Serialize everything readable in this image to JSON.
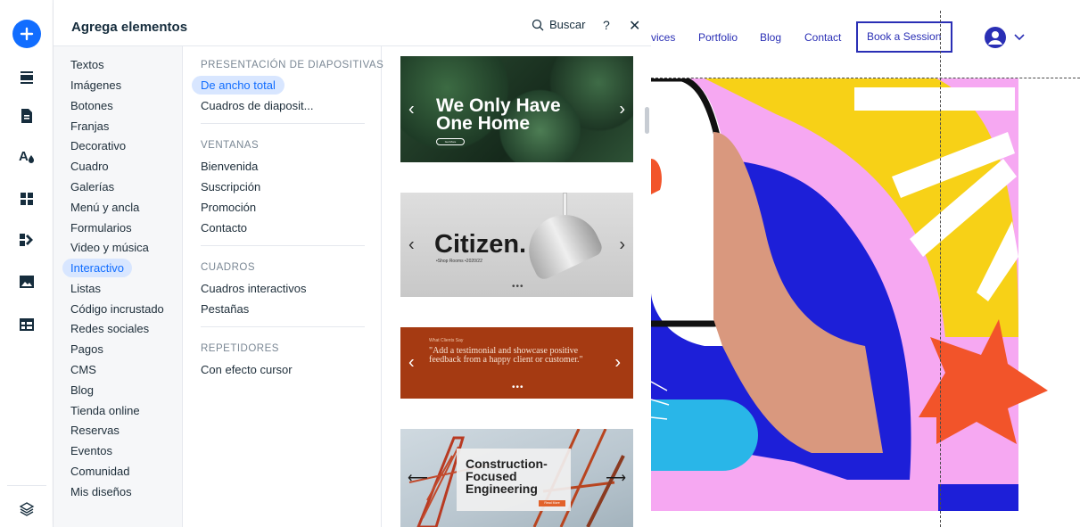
{
  "rail": {
    "items": [
      {
        "name": "add-elements",
        "icon": "plus-icon"
      },
      {
        "name": "sections",
        "icon": "sections-icon"
      },
      {
        "name": "pages",
        "icon": "page-icon"
      },
      {
        "name": "theme",
        "icon": "theme-icon"
      },
      {
        "name": "apps",
        "icon": "apps-icon"
      },
      {
        "name": "business",
        "icon": "business-icon"
      },
      {
        "name": "media",
        "icon": "image-icon"
      },
      {
        "name": "cms",
        "icon": "table-icon"
      },
      {
        "name": "layers",
        "icon": "layers-icon"
      }
    ],
    "accent": "#116dff"
  },
  "panel": {
    "title": "Agrega elementos",
    "search_label": "Buscar",
    "help_label": "?",
    "close_label": "✕"
  },
  "categories": [
    "Textos",
    "Imágenes",
    "Botones",
    "Franjas",
    "Decorativo",
    "Cuadro",
    "Galerías",
    "Menú y ancla",
    "Formularios",
    "Video y música",
    "Interactivo",
    "Listas",
    "Código incrustado",
    "Redes sociales",
    "Pagos",
    "CMS",
    "Blog",
    "Tienda online",
    "Reservas",
    "Eventos",
    "Comunidad",
    "Mis diseños"
  ],
  "active_category": "Interactivo",
  "sections": [
    {
      "title": "PRESENTACIÓN DE DIAPOSITIVAS",
      "items": [
        "De ancho total",
        "Cuadros de diaposit..."
      ]
    },
    {
      "title": "VENTANAS",
      "items": [
        "Bienvenida",
        "Suscripción",
        "Promoción",
        "Contacto"
      ]
    },
    {
      "title": "CUADROS",
      "items": [
        "Cuadros interactivos",
        "Pestañas"
      ]
    },
    {
      "title": "REPETIDORES",
      "items": [
        "Con efecto cursor"
      ]
    }
  ],
  "active_subitem": "De ancho total",
  "thumbs": {
    "t1": {
      "title": "We Only Have One Home",
      "button": "Get More"
    },
    "t2": {
      "title": "Citizen.",
      "sub": "•Shop Rooms  •2020/22",
      "dots": "•••"
    },
    "t3": {
      "small": "What Clients Say",
      "quote": "\"Add a testimonial and showcase positive feedback from a happy client or customer.\"",
      "dots": "•••"
    },
    "t4": {
      "title": "Construction-Focused Engineering",
      "button": "Read More"
    },
    "arrow_left": "‹",
    "arrow_right": "›",
    "arrow_long_left": "⟵",
    "arrow_long_right": "⟶"
  },
  "site": {
    "nav": [
      "vices",
      "Portfolio",
      "Blog",
      "Contact"
    ],
    "cta": "Book a Session",
    "brand_color": "#2a2fb5",
    "colors": {
      "pink": "#f6a8f2",
      "blue": "#1d1fd8",
      "yellow": "#f7d117",
      "orange": "#f2542a",
      "cyan": "#29b6e8"
    }
  }
}
